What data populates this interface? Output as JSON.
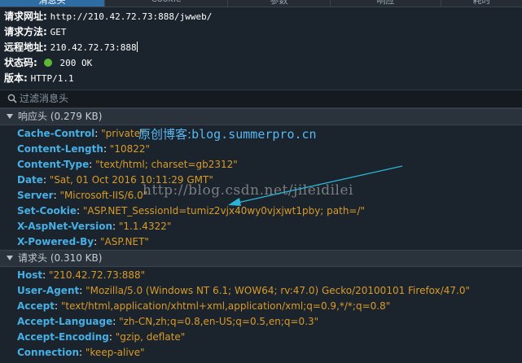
{
  "tabs": [
    {
      "label": "消息头",
      "active": true
    },
    {
      "label": "Cookie",
      "active": false
    },
    {
      "label": "参数",
      "active": false
    },
    {
      "label": "响应",
      "active": false
    },
    {
      "label": "耗时",
      "active": false
    }
  ],
  "summary": {
    "url": {
      "label": "请求网址:",
      "value": "http://210.42.72.73:888/jwweb/"
    },
    "method": {
      "label": "请求方法:",
      "value": "GET"
    },
    "remote": {
      "label": "远程地址:",
      "value": "210.42.72.73:888"
    },
    "status": {
      "label": "状态码:",
      "value": "200 OK",
      "color": "#5fb832"
    },
    "version": {
      "label": "版本:",
      "value": "HTTP/1.1"
    }
  },
  "filter": {
    "placeholder": "过滤消息头",
    "icon": "search-icon"
  },
  "response_headers": {
    "title": "响应头 (0.279 KB)",
    "rows": [
      {
        "name": "Cache-Control",
        "value": "\"private\""
      },
      {
        "name": "Content-Length",
        "value": "\"10822\""
      },
      {
        "name": "Content-Type",
        "value": "\"text/html; charset=gb2312\""
      },
      {
        "name": "Date",
        "value": "\"Sat, 01 Oct 2016 10:11:29 GMT\""
      },
      {
        "name": "Server",
        "value": "\"Microsoft-IIS/6.0\""
      },
      {
        "name": "Set-Cookie",
        "value": "\"ASP.NET_SessionId=tumiz2vjx40wy0vjxjwt1pby; path=/\""
      },
      {
        "name": "X-AspNet-Version",
        "value": "\"1.1.4322\""
      },
      {
        "name": "X-Powered-By",
        "value": "\"ASP.NET\""
      }
    ]
  },
  "request_headers": {
    "title": "请求头 (0.310 KB)",
    "rows": [
      {
        "name": "Host",
        "value": "\"210.42.72.73:888\""
      },
      {
        "name": "User-Agent",
        "value": "\"Mozilla/5.0 (Windows NT 6.1; WOW64; rv:47.0) Gecko/20100101 Firefox/47.0\""
      },
      {
        "name": "Accept",
        "value": "\"text/html,application/xhtml+xml,application/xml;q=0.9,*/*;q=0.8\""
      },
      {
        "name": "Accept-Language",
        "value": "\"zh-CN,zh;q=0.8,en-US;q=0.5,en;q=0.3\""
      },
      {
        "name": "Accept-Encoding",
        "value": "\"gzip, deflate\""
      },
      {
        "name": "Connection",
        "value": "\"keep-alive\""
      }
    ]
  },
  "annotation": {
    "prefix": "原创博客:",
    "site": "blog.summerpro.cn"
  },
  "watermark": "http://blog.csdn.net/jileidilei",
  "colors": {
    "background": "#1b232c",
    "header_name": "#46afe3",
    "header_value": "#d99b28",
    "annotation": "#58b8f2",
    "arrow": "#2bb4d6",
    "active_tab": "#2e6da4"
  }
}
